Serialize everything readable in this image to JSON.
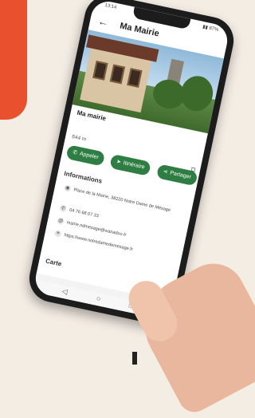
{
  "colors": {
    "accent": "#2e7d43",
    "brand_block": "#e8502e"
  },
  "status_bar": {
    "time": "13:14",
    "right": "▮▮ 87%"
  },
  "app_bar": {
    "back_icon": "arrow-left-icon",
    "title": "Ma Mairie"
  },
  "place": {
    "name": "Ma mairie",
    "distance": "644 m"
  },
  "actions": {
    "call": "Appeler",
    "route": "Itinéraire",
    "share": "Partager",
    "bookmark_icon": "bookmark-icon"
  },
  "info": {
    "title": "Informations",
    "address": "Place de la Mairie, 38220 Notre Dame de Mésage",
    "phone": "04 76 68 07 33",
    "email": "mairie.ndmesage@wanadoo.fr",
    "website": "https://www.notredamedemesage.fr"
  },
  "map": {
    "title": "Carte"
  }
}
